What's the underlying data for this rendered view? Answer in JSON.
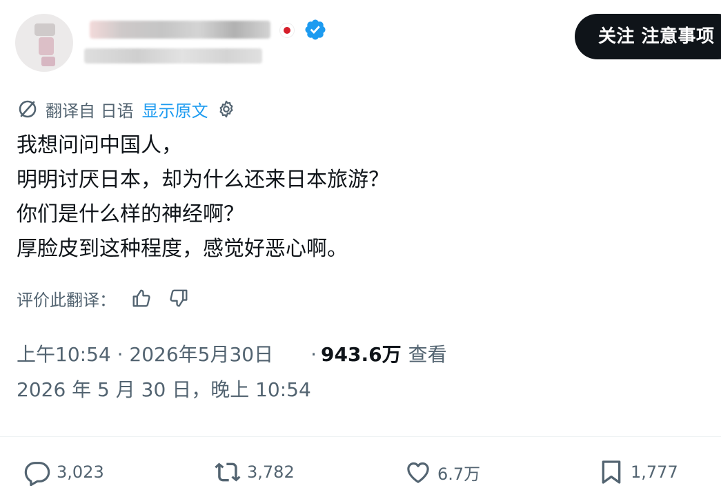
{
  "header": {
    "follow_label": "关注 注意事项"
  },
  "translation": {
    "translated_from": "翻译自 日语",
    "show_original": "显示原文"
  },
  "tweet": {
    "lines": [
      "我想问问中国人，",
      "明明讨厌日本，却为什么还来日本旅游？",
      "你们是什么样的神经啊？",
      "厚脸皮到这种程度，感觉好恶心啊。"
    ]
  },
  "rating": {
    "label": "评价此翻译："
  },
  "meta": {
    "time_date": "上午10:54 · 2026年5月30日",
    "views_dot": "·",
    "views_count": "943.6万",
    "views_label": "查看",
    "local_time": "2026 年 5 月 30 日，晚上 10:54"
  },
  "actions": {
    "replies": "3,023",
    "reposts": "3,782",
    "likes": "6.7万",
    "bookmarks": "1,777"
  },
  "colors": {
    "text": "#0f1419",
    "muted": "#536471",
    "link": "#1d9bf0",
    "verified": "#1d9bf0",
    "button_bg": "#0f1419"
  },
  "icons": {
    "verified": "verified-badge-icon",
    "translate": "translate-icon",
    "settings": "gear-icon",
    "thumbs_up": "thumbs-up-icon",
    "thumbs_down": "thumbs-down-icon",
    "reply": "reply-icon",
    "repost": "repost-icon",
    "like": "heart-icon",
    "bookmark": "bookmark-icon"
  }
}
